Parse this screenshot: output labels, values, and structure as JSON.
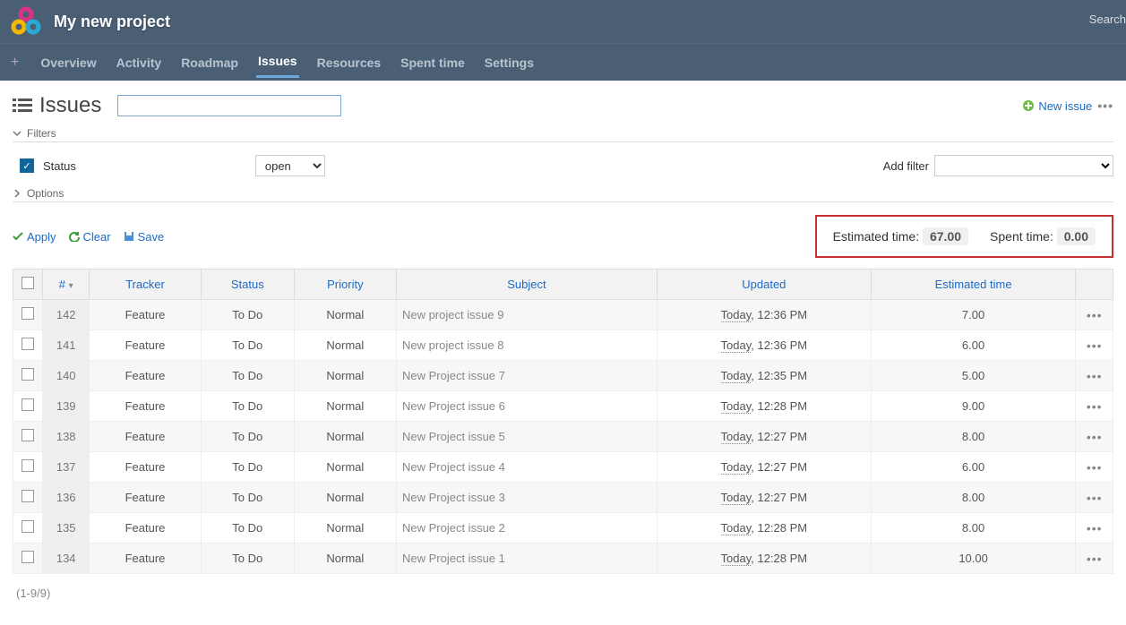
{
  "header": {
    "project_title": "My new project",
    "search_label": "Search"
  },
  "nav": {
    "items": [
      "Overview",
      "Activity",
      "Roadmap",
      "Issues",
      "Resources",
      "Spent time",
      "Settings"
    ],
    "active_index": 3
  },
  "page": {
    "title": "Issues",
    "new_issue_label": "New issue"
  },
  "filters": {
    "section_label": "Filters",
    "status_label": "Status",
    "status_value": "open",
    "add_filter_label": "Add filter",
    "options_label": "Options"
  },
  "actions": {
    "apply": "Apply",
    "clear": "Clear",
    "save": "Save"
  },
  "totals": {
    "est_label": "Estimated time:",
    "est_value": "67.00",
    "spent_label": "Spent time:",
    "spent_value": "0.00"
  },
  "table": {
    "columns": {
      "id": "#",
      "tracker": "Tracker",
      "status": "Status",
      "priority": "Priority",
      "subject": "Subject",
      "updated": "Updated",
      "estimated": "Estimated time"
    },
    "today_label": "Today",
    "rows": [
      {
        "id": "142",
        "tracker": "Feature",
        "status": "To Do",
        "priority": "Normal",
        "subject": "New project issue 9",
        "time": ", 12:36 PM",
        "est": "7.00"
      },
      {
        "id": "141",
        "tracker": "Feature",
        "status": "To Do",
        "priority": "Normal",
        "subject": "New project issue 8",
        "time": ", 12:36 PM",
        "est": "6.00"
      },
      {
        "id": "140",
        "tracker": "Feature",
        "status": "To Do",
        "priority": "Normal",
        "subject": "New Project issue 7",
        "time": ", 12:35 PM",
        "est": "5.00"
      },
      {
        "id": "139",
        "tracker": "Feature",
        "status": "To Do",
        "priority": "Normal",
        "subject": "New Project issue 6",
        "time": ", 12:28 PM",
        "est": "9.00"
      },
      {
        "id": "138",
        "tracker": "Feature",
        "status": "To Do",
        "priority": "Normal",
        "subject": "New Project issue 5",
        "time": ", 12:27 PM",
        "est": "8.00"
      },
      {
        "id": "137",
        "tracker": "Feature",
        "status": "To Do",
        "priority": "Normal",
        "subject": "New Project issue 4",
        "time": ", 12:27 PM",
        "est": "6.00"
      },
      {
        "id": "136",
        "tracker": "Feature",
        "status": "To Do",
        "priority": "Normal",
        "subject": "New Project issue 3",
        "time": ", 12:27 PM",
        "est": "8.00"
      },
      {
        "id": "135",
        "tracker": "Feature",
        "status": "To Do",
        "priority": "Normal",
        "subject": "New Project issue 2",
        "time": ", 12:28 PM",
        "est": "8.00"
      },
      {
        "id": "134",
        "tracker": "Feature",
        "status": "To Do",
        "priority": "Normal",
        "subject": "New Project issue 1",
        "time": ", 12:28 PM",
        "est": "10.00"
      }
    ]
  },
  "pager": "(1-9/9)"
}
